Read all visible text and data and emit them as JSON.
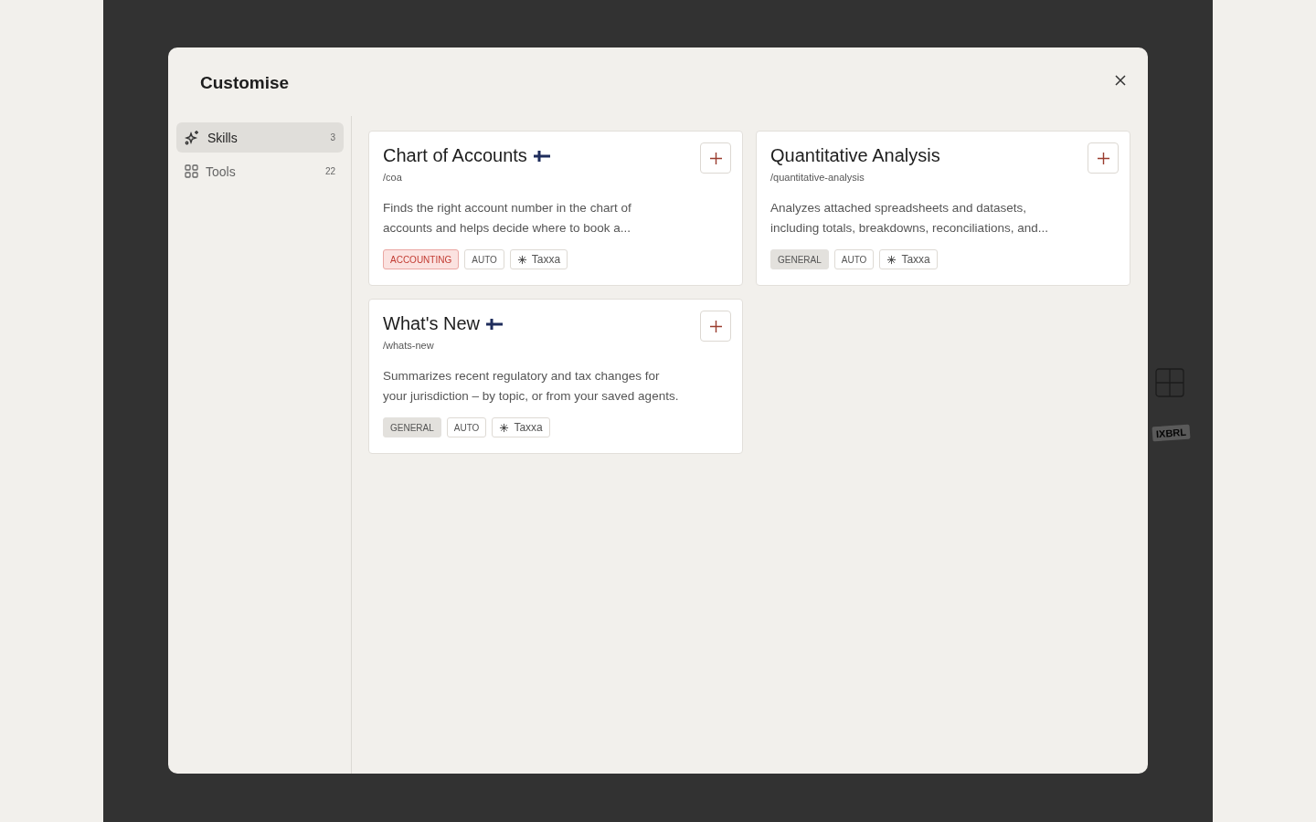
{
  "background": {
    "label": "IXBRL"
  },
  "dialog": {
    "title": "Customise",
    "sidebar": [
      {
        "label": "Skills",
        "count": "3",
        "selected": true
      },
      {
        "label": "Tools",
        "count": "22",
        "selected": false
      }
    ],
    "cards": [
      {
        "title": "Chart of Accounts",
        "flag": true,
        "slug": "/coa",
        "description": "Finds the right account number in the chart of accounts and helps decide where to book a...",
        "tags": [
          {
            "kind": "category",
            "label": "ACCOUNTING",
            "color": "#fbe2e0"
          },
          {
            "kind": "mode",
            "label": "AUTO"
          },
          {
            "kind": "source",
            "label": "Taxxa"
          }
        ]
      },
      {
        "title": "Quantitative Analysis",
        "slug": "/quantitative-analysis",
        "description": "Analyzes attached spreadsheets and datasets, including totals, breakdowns, reconciliations, and...",
        "flag": false,
        "tags": [
          {
            "kind": "category",
            "label": "GENERAL",
            "color": "#e3e1dd"
          },
          {
            "kind": "mode",
            "label": "AUTO"
          },
          {
            "kind": "source",
            "label": "Taxxa"
          }
        ]
      },
      {
        "title": "What's New",
        "flag": true,
        "slug": "/whats-new",
        "description": "Summarizes recent regulatory and tax changes for your jurisdiction – by topic, or from your saved agents.",
        "tags": [
          {
            "kind": "category",
            "label": "GENERAL",
            "color": "#e3e1dd"
          },
          {
            "kind": "mode",
            "label": "AUTO"
          },
          {
            "kind": "source",
            "label": "Taxxa"
          }
        ]
      }
    ]
  }
}
